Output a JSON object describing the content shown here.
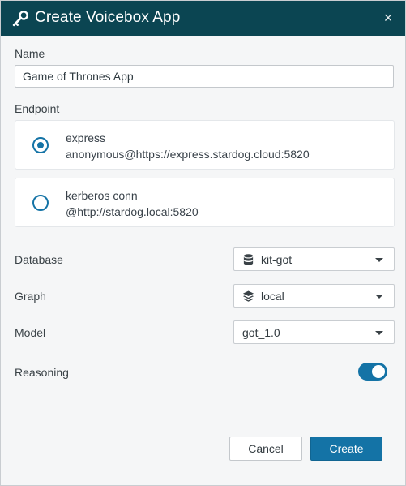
{
  "header": {
    "title": "Create Voicebox App",
    "icon": "key-icon",
    "close_label": "×"
  },
  "name": {
    "label": "Name",
    "value": "Game of Thrones App"
  },
  "endpoint": {
    "label": "Endpoint",
    "options": [
      {
        "name": "express",
        "url": "anonymous@https://express.stardog.cloud:5820",
        "selected": true
      },
      {
        "name": "kerberos conn",
        "url": "@http://stardog.local:5820",
        "selected": false
      }
    ]
  },
  "database": {
    "label": "Database",
    "value": "kit-got",
    "icon": "database-icon"
  },
  "graph": {
    "label": "Graph",
    "value": "local",
    "icon": "layers-icon"
  },
  "model": {
    "label": "Model",
    "value": "got_1.0"
  },
  "reasoning": {
    "label": "Reasoning",
    "enabled": true
  },
  "actions": {
    "cancel_label": "Cancel",
    "create_label": "Create"
  },
  "colors": {
    "header_bg": "#0b4552",
    "accent": "#1473a6",
    "dialog_bg": "#f5f6f7"
  }
}
